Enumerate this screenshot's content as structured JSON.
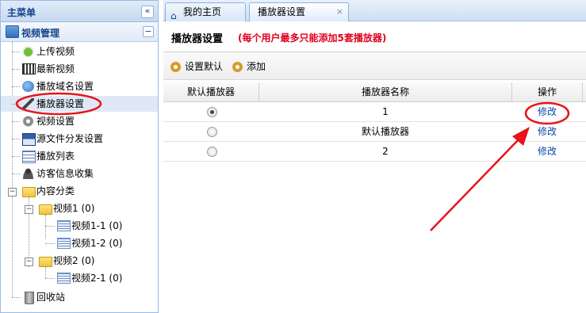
{
  "sidebar": {
    "title": "主菜单",
    "collapse_icon": "«",
    "section": {
      "label": "视频管理",
      "toggle": "−"
    },
    "items": [
      {
        "label": "上传视频",
        "icon": "upload-icon"
      },
      {
        "label": "最新视频",
        "icon": "film-icon"
      },
      {
        "label": "播放域名设置",
        "icon": "globe-icon"
      },
      {
        "label": "播放器设置",
        "icon": "wand-icon",
        "selected": true
      },
      {
        "label": "视频设置",
        "icon": "gear-icon"
      },
      {
        "label": "源文件分发设置",
        "icon": "floppy-icon"
      },
      {
        "label": "播放列表",
        "icon": "list-icon"
      },
      {
        "label": "访客信息收集",
        "icon": "user-icon"
      }
    ],
    "category": {
      "label": "内容分类",
      "children": [
        {
          "label": "视频1 (0)",
          "children": [
            "视频1-1 (0)",
            "视频1-2 (0)"
          ]
        },
        {
          "label": "视频2 (0)",
          "children": [
            "视频2-1 (0)"
          ]
        }
      ]
    },
    "recycle": "回收站"
  },
  "tabs": [
    {
      "label": "我的主页",
      "icon": "home-icon",
      "active": false
    },
    {
      "label": "播放器设置",
      "active": true,
      "close": "×"
    }
  ],
  "panel": {
    "title": "播放器设置",
    "note": "(每个用户最多只能添加5套播放器)"
  },
  "toolbar": {
    "set_default": "设置默认",
    "add": "添加"
  },
  "table": {
    "headers": [
      "默认播放器",
      "播放器名称",
      "操作"
    ],
    "rows": [
      {
        "default": true,
        "name": "1",
        "action": "修改"
      },
      {
        "default": false,
        "name": "默认播放器",
        "action": "修改"
      },
      {
        "default": false,
        "name": "2",
        "action": "修改"
      }
    ]
  },
  "colors": {
    "annotation": "#e8131b",
    "link": "#0c45ab",
    "note": "#e0001b"
  }
}
